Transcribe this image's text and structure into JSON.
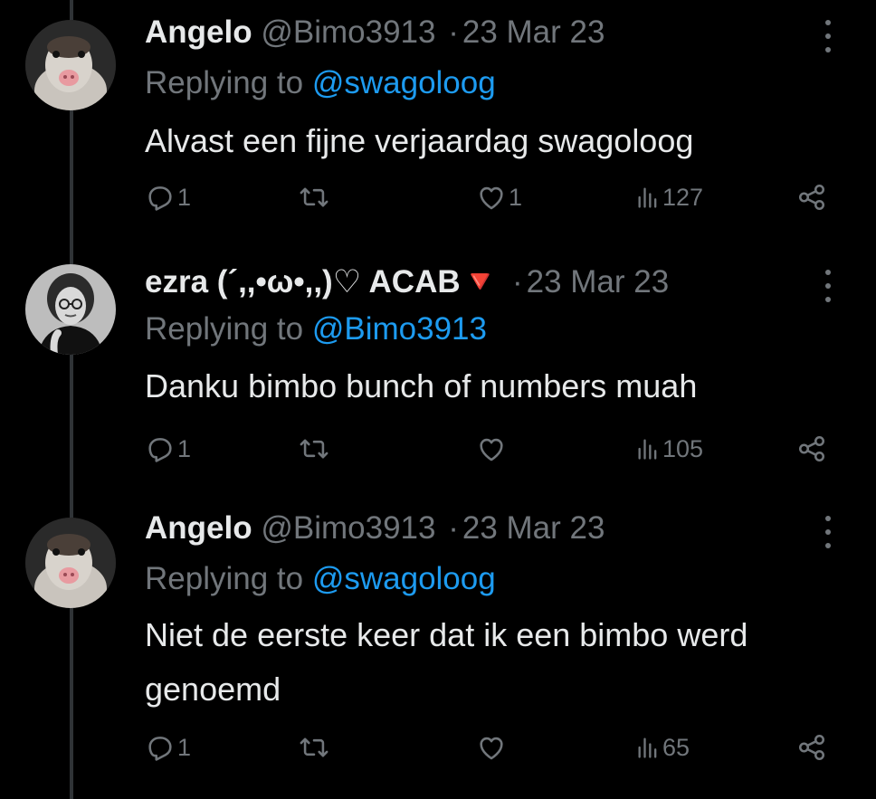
{
  "tweets": [
    {
      "name": "Angelo",
      "handle": "@Bimo3913",
      "dot": "·",
      "date": "23 Mar 23",
      "replying_prefix": "Replying to ",
      "replying_to": "@swagoloog",
      "text": "Alvast een fijne verjaardag swagoloog",
      "reply_count": "1",
      "like_count": "1",
      "view_count": "127",
      "avatar_icon": "ferret-avatar"
    },
    {
      "name": "ezra (´,,•ω•,,)♡ ACAB",
      "name_emoji": "🔻",
      "dot": "·",
      "date": "23 Mar 23",
      "replying_prefix": "Replying to ",
      "replying_to": "@Bimo3913",
      "text": "Danku bimbo bunch of numbers muah",
      "reply_count": "1",
      "like_count": "",
      "view_count": "105",
      "avatar_icon": "person-avatar"
    },
    {
      "name": "Angelo",
      "handle": "@Bimo3913",
      "dot": "·",
      "date": "23 Mar 23",
      "replying_prefix": "Replying to ",
      "replying_to": "@swagoloog",
      "text": "Niet de eerste keer dat ik een bimbo werd genoemd",
      "reply_count": "1",
      "like_count": "",
      "view_count": "65",
      "avatar_icon": "ferret-avatar"
    }
  ],
  "colors": {
    "background": "#000000",
    "text": "#e7e9ea",
    "muted": "#71767b",
    "link": "#1d9bf0",
    "thread_line": "#2f3336"
  }
}
